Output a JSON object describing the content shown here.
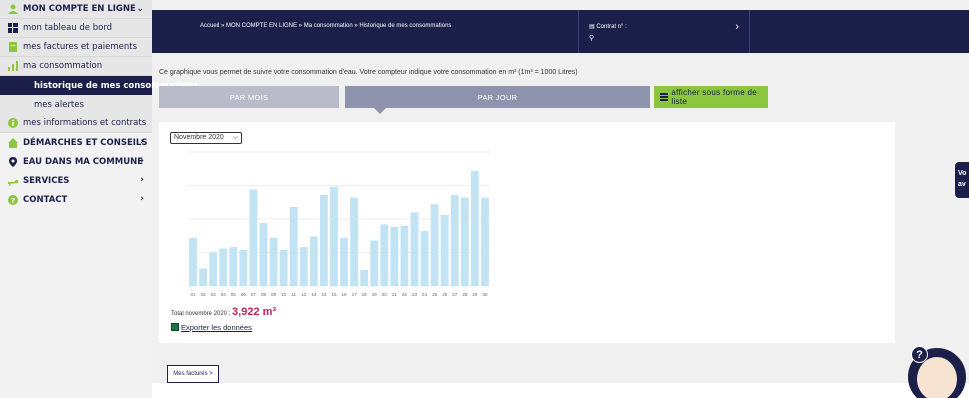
{
  "sidebar": {
    "items": [
      {
        "label": "MON COMPTE EN LIGNE",
        "icon": "user-icon",
        "icon_color": "#8cc63f"
      },
      {
        "label": "mon tableau de bord",
        "icon": "dashboard-icon",
        "icon_color": "#1b1f4a"
      },
      {
        "label": "mes factures et paiements",
        "icon": "invoice-icon",
        "icon_color": "#8cc63f"
      },
      {
        "label": "ma consommation",
        "icon": "chart-icon",
        "icon_color": "#8cc63f"
      },
      {
        "label": "historique de mes consommations"
      },
      {
        "label": "mes alertes"
      },
      {
        "label": "mes informations et contrats",
        "icon": "info-icon",
        "icon_color": "#8cc63f"
      },
      {
        "label": "DÉMARCHES ET CONSEILS",
        "icon": "home-icon",
        "icon_color": "#8cc63f"
      },
      {
        "label": "EAU DANS MA COMMUNE",
        "icon": "pin-icon",
        "icon_color": "#1b1f4a"
      },
      {
        "label": "SERVICES",
        "icon": "tap-icon",
        "icon_color": "#8cc63f"
      },
      {
        "label": "CONTACT",
        "icon": "contact-icon",
        "icon_color": "#8cc63f"
      }
    ]
  },
  "topbar": {
    "breadcrumb": "Accueil » MON COMPTE EN LIGNE » Ma consommation » Historique de mes consommations",
    "contract_label": "Contrat n° :"
  },
  "content": {
    "intro": "Ce graphique vous permet de suivre votre consommation d'eau. Votre compteur indique votre consommation en m³ (1m³ = 1000 Litres)",
    "tab_month": "PAR MOIS",
    "tab_day": "PAR JOUR",
    "tab_list": "afficher sous forme de liste",
    "month_select": "Novembre 2020",
    "total_label": "Total novembre 2020 :",
    "total_value": "3,922 m³",
    "export_label": "Exporter les données",
    "factures_button": "Mes factures >",
    "side_tab": "Vo av"
  },
  "colors": {
    "navy": "#1b1f4a",
    "green": "#8cc63f",
    "bar": "#c2e3f3",
    "accent": "#c0245c"
  },
  "chart_data": {
    "type": "bar",
    "categories": [
      "01",
      "02",
      "03",
      "04",
      "05",
      "06",
      "07",
      "08",
      "09",
      "10",
      "11",
      "12",
      "13",
      "14",
      "15",
      "16",
      "17",
      "18",
      "19",
      "20",
      "21",
      "22",
      "23",
      "24",
      "25",
      "26",
      "27",
      "28",
      "29",
      "30"
    ],
    "values": [
      0.072,
      0.026,
      0.05,
      0.056,
      0.058,
      0.054,
      0.144,
      0.094,
      0.072,
      0.054,
      0.118,
      0.058,
      0.074,
      0.136,
      0.148,
      0.072,
      0.132,
      0.024,
      0.068,
      0.092,
      0.088,
      0.09,
      0.11,
      0.082,
      0.122,
      0.106,
      0.136,
      0.132,
      0.172,
      0.132
    ],
    "ylim": [
      0,
      0.2
    ]
  }
}
